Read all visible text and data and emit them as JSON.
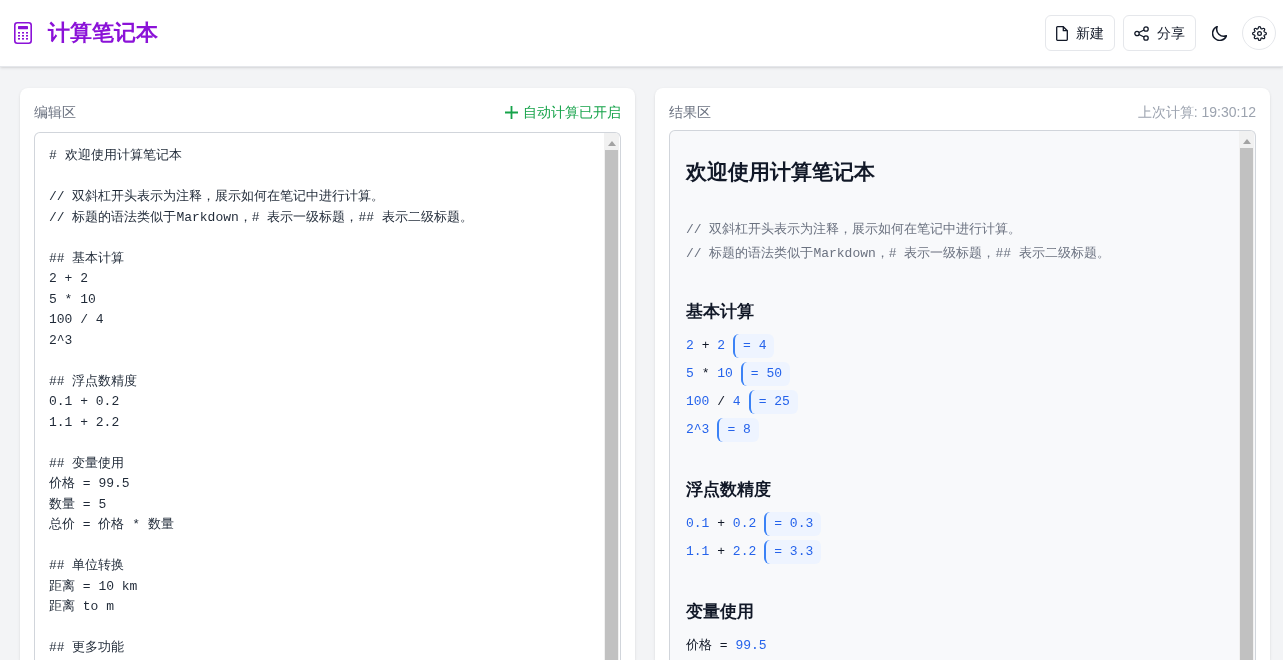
{
  "header": {
    "title": "计算笔记本",
    "buttons": [
      {
        "kind": "new",
        "label": "新建"
      },
      {
        "kind": "share",
        "label": "分享"
      }
    ]
  },
  "editor": {
    "label": "编辑区",
    "status": "自动计算已开启",
    "sections": [
      [
        "# 欢迎使用计算笔记本"
      ],
      [
        "// 双斜杠开头表示为注释，展示如何在笔记中进行计算。",
        "// 标题的语法类似于Markdown，# 表示一级标题，## 表示二级标题。"
      ],
      [
        "## 基本计算",
        "2 + 2",
        "5 * 10",
        "100 / 4",
        "2^3"
      ],
      [
        "## 浮点数精度",
        "0.1 + 0.2",
        "1.1 + 2.2"
      ],
      [
        "## 变量使用",
        "价格 = 99.5",
        "数量 = 5",
        "总价 = 价格 * 数量"
      ],
      [
        "## 单位转换",
        "距离 = 10 km",
        "距离 to m"
      ],
      [
        "## 更多功能"
      ]
    ]
  },
  "result": {
    "label": "结果区",
    "last_calc": "上次计算: 19:30:12",
    "blocks": [
      {
        "kind": "h1",
        "text": "欢迎使用计算笔记本"
      },
      {
        "kind": "comment",
        "text": "// 双斜杠开头表示为注释，展示如何在笔记中进行计算。"
      },
      {
        "kind": "comment",
        "text": "// 标题的语法类似于Markdown，# 表示一级标题，## 表示二级标题。"
      },
      {
        "kind": "h2",
        "text": "基本计算"
      },
      {
        "kind": "expression",
        "tokens": [
          {
            "kind": "number",
            "text": "2"
          },
          {
            "kind": "operator",
            "text": "+"
          },
          {
            "kind": "number",
            "text": "2"
          }
        ],
        "result": "= 4"
      },
      {
        "kind": "expression",
        "tokens": [
          {
            "kind": "number",
            "text": "5"
          },
          {
            "kind": "operator",
            "text": "*"
          },
          {
            "kind": "number",
            "text": "10"
          }
        ],
        "result": "= 50"
      },
      {
        "kind": "expression",
        "tokens": [
          {
            "kind": "number",
            "text": "100"
          },
          {
            "kind": "operator",
            "text": "/"
          },
          {
            "kind": "number",
            "text": "4"
          }
        ],
        "result": "= 25"
      },
      {
        "kind": "expression",
        "tokens": [
          {
            "kind": "number",
            "text": "2^3"
          }
        ],
        "result": "= 8"
      },
      {
        "kind": "h2",
        "text": "浮点数精度"
      },
      {
        "kind": "expression",
        "tokens": [
          {
            "kind": "number",
            "text": "0.1"
          },
          {
            "kind": "operator",
            "text": "+"
          },
          {
            "kind": "number",
            "text": "0.2"
          }
        ],
        "result": "= 0.3"
      },
      {
        "kind": "expression",
        "tokens": [
          {
            "kind": "number",
            "text": "1.1"
          },
          {
            "kind": "operator",
            "text": "+"
          },
          {
            "kind": "number",
            "text": "2.2"
          }
        ],
        "result": "= 3.3"
      },
      {
        "kind": "h2",
        "text": "变量使用"
      },
      {
        "kind": "expression",
        "tokens": [
          {
            "kind": "name",
            "text": "价格"
          },
          {
            "kind": "operator",
            "text": "="
          },
          {
            "kind": "number",
            "text": "99.5"
          }
        ]
      }
    ]
  }
}
